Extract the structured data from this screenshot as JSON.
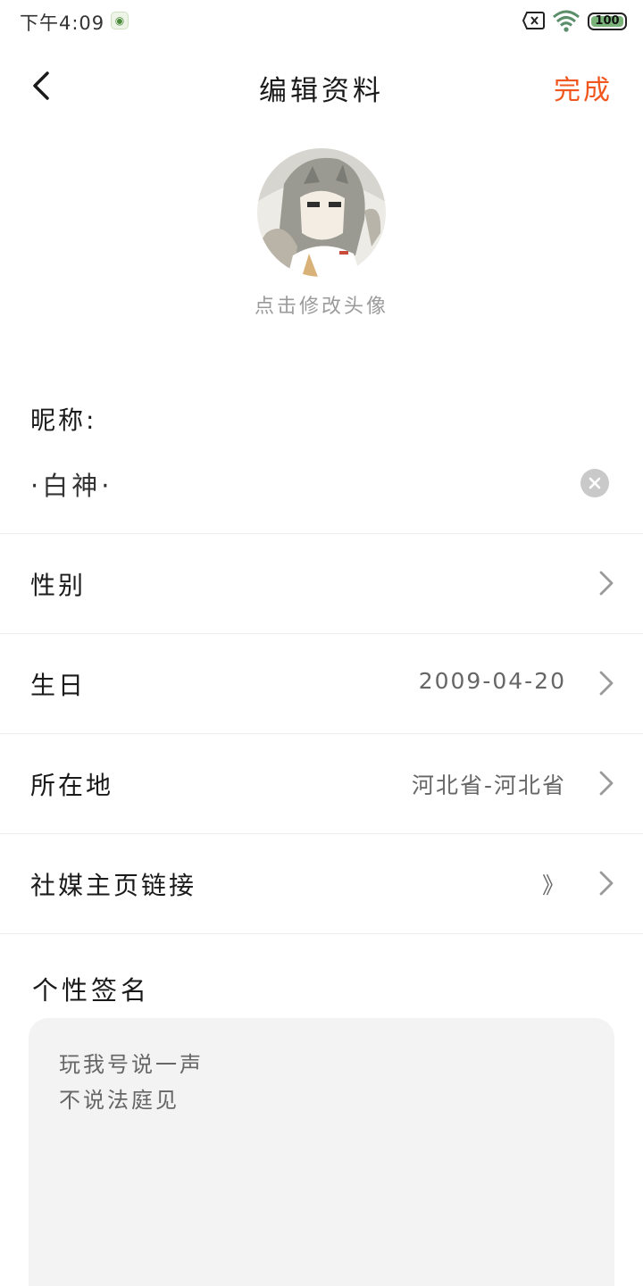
{
  "status_bar": {
    "time": "下午4:09",
    "battery_level": "100",
    "battery_percent": 100,
    "icons": [
      "app-notification-icon",
      "sim-disabled-icon",
      "wifi-icon",
      "battery-icon"
    ]
  },
  "header": {
    "title": "编辑资料",
    "done_label": "完成",
    "back_icon": "chevron-left-icon"
  },
  "avatar": {
    "hint": "点击修改头像"
  },
  "nickname": {
    "label": "昵称:",
    "value": "·白神·",
    "clear_icon": "clear-icon"
  },
  "rows": [
    {
      "label": "性别",
      "value": ""
    },
    {
      "label": "生日",
      "value": "2009-04-20"
    },
    {
      "label": "所在地",
      "value": "河北省-河北省"
    },
    {
      "label": "社媒主页链接",
      "value": "》"
    }
  ],
  "signature": {
    "label": "个性签名",
    "lines": [
      "玩我号说一声",
      "不说法庭见"
    ]
  },
  "colors": {
    "accent": "#f0561e",
    "text": "#1a1a1a",
    "secondary_text": "#666666",
    "hint_text": "#9b9b9b",
    "divider": "#ececec",
    "signature_bg": "#f3f3f3",
    "clear_button": "#c9c9c9"
  }
}
